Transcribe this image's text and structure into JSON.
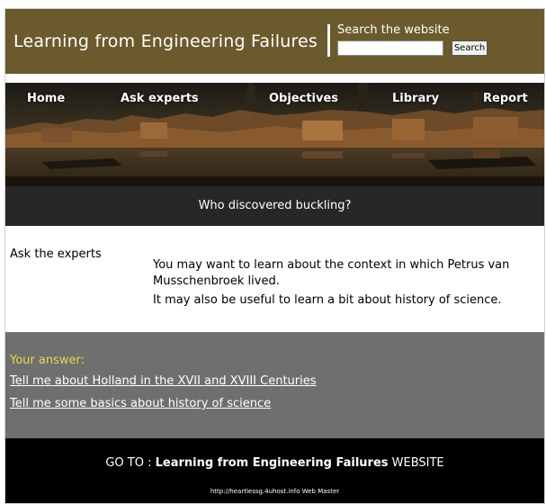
{
  "header": {
    "site_title": "Learning from Engineering Failures",
    "search_label": "Search the website",
    "search_value": "",
    "search_button": "Search"
  },
  "nav": {
    "items": [
      {
        "label": "Home"
      },
      {
        "label": "Ask experts"
      },
      {
        "label": "Objectives"
      },
      {
        "label": "Library"
      },
      {
        "label": "Report"
      }
    ]
  },
  "question": "Who discovered buckling?",
  "content": {
    "section_label": "Ask the experts",
    "hints": [
      "You may want to learn about the context in which Petrus van Musschenbroek lived.",
      "It may also be useful to learn a bit about history of science."
    ]
  },
  "answers": {
    "label": "Your answer:",
    "links": [
      "Tell me about Holland in the XVII and XVIII Centuries",
      "Tell me some basics about history of science"
    ]
  },
  "footer": {
    "goto_prefix": "GO TO : ",
    "goto_strong": "Learning from Engineering Failures",
    "goto_suffix": " WEBSITE",
    "credit": "http://heartlessg.4uhost.info Web Master"
  },
  "colors": {
    "header_bg": "#6b5a2c",
    "question_bg": "#272727",
    "answers_bg": "#6f6f6f",
    "answer_label": "#e8d84a",
    "footer_bg": "#000000"
  }
}
